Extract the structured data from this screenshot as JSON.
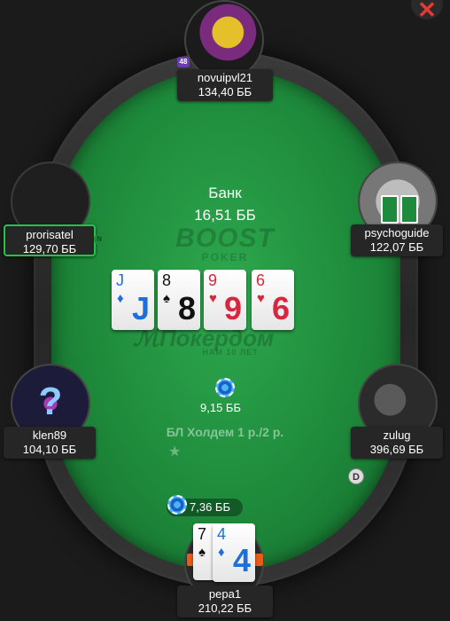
{
  "header": {
    "close_label": "✕"
  },
  "pot": {
    "title": "Банк",
    "amount": "16,51 ББ"
  },
  "logos": {
    "boost": "BOOST",
    "boost_sub": "POKER",
    "pokerdom": "Покердом",
    "pokerdom_sub": "НАМ 10 ЛЕТ"
  },
  "board": [
    {
      "rank": "J",
      "suit": "♦",
      "color": "#1e6fd9"
    },
    {
      "rank": "8",
      "suit": "♠",
      "color": "#111111"
    },
    {
      "rank": "9",
      "suit": "♥",
      "color": "#d7263d"
    },
    {
      "rank": "6",
      "suit": "♥",
      "color": "#d7263d"
    }
  ],
  "players": {
    "top": {
      "name": "novuipvl21",
      "stack": "134,40 ББ",
      "badge": "48"
    },
    "left_upper": {
      "name": "prorisatel",
      "stack": "129,70 ББ",
      "badge": "N"
    },
    "right_upper": {
      "name": "psychoguide",
      "stack": "122,07 ББ"
    },
    "left_lower": {
      "name": "klen89",
      "stack": "104,10 ББ"
    },
    "right_lower": {
      "name": "zulug",
      "stack": "396,69 ББ"
    },
    "bottom": {
      "name": "pepa1",
      "stack": "210,22 ББ"
    }
  },
  "bets": {
    "center": "9,15 ББ",
    "hero": "7,36 ББ"
  },
  "hero_cards": [
    {
      "rank": "7",
      "suit": "♠",
      "color": "#111111"
    },
    {
      "rank": "4",
      "suit": "♦",
      "color": "#1e6fd9"
    }
  ],
  "game": {
    "label": "БЛ Холдем 1 р./2 р.",
    "star": "★"
  },
  "dealer_button": "D"
}
